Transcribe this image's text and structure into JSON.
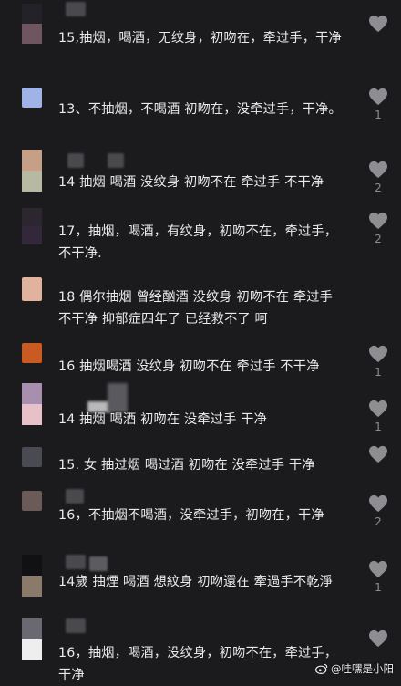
{
  "comments": [
    {
      "text": "15,抽烟，喝酒，无纹身，初吻在，牵过手，干净",
      "likes": "",
      "avatar": [
        "#222228",
        "#6e5560"
      ]
    },
    {
      "text": "13、不抽烟，不喝酒 初吻在，没牵过手，干净。",
      "likes": "1",
      "avatar": [
        "#9fb3e6"
      ]
    },
    {
      "text": "14 抽烟 喝酒 没纹身 初吻不在 牵过手 不干净",
      "likes": "2",
      "avatar": [
        "#c5a086",
        "#b7b9a3"
      ]
    },
    {
      "text": "17，抽烟，喝酒，有纹身，初吻不在，牵过手，不干净.",
      "likes": "2",
      "avatar": [
        "#2b2630",
        "#32283a"
      ]
    },
    {
      "text": "18 偶尔抽烟 曾经酗酒 没纹身 初吻不在 牵过手 不干净 抑郁症四年了 已经救不了 呵",
      "likes": "",
      "avatar": [
        "#e7b9a2",
        "#d7a88f"
      ]
    },
    {
      "text": "16 抽烟喝酒 没纹身 初吻不在 牵过手 不干净",
      "likes": "1",
      "avatar": [
        "#c85a22"
      ]
    },
    {
      "text": "14 抽烟 喝酒 初吻在 没牵过手 干净",
      "likes": "1",
      "avatar": [
        "#a88fb0",
        "#e7c0c8"
      ]
    },
    {
      "text": "15. 女 抽过烟 喝过酒 初吻在 没牵过手 干净",
      "likes": "",
      "avatar": [
        "#4a4b52"
      ]
    },
    {
      "text": "16，不抽烟不喝酒，没牵过手，初吻在，干净",
      "likes": "2",
      "avatar": [
        "#6a5a58"
      ]
    },
    {
      "text": "14歲 抽煙 喝酒 想紋身 初吻還在 牽過手不乾淨",
      "likes": "1",
      "avatar": [
        "#111114",
        "#8a7a6a"
      ]
    },
    {
      "text": "16，抽烟，喝酒，没纹身，初吻不在，牵过手，干净",
      "likes": "",
      "avatar": [
        "#6a6870",
        "#eeeeee"
      ]
    }
  ],
  "watermark": {
    "text": "@哇嘿是小阳",
    "icon": "weibo-logo-icon"
  }
}
